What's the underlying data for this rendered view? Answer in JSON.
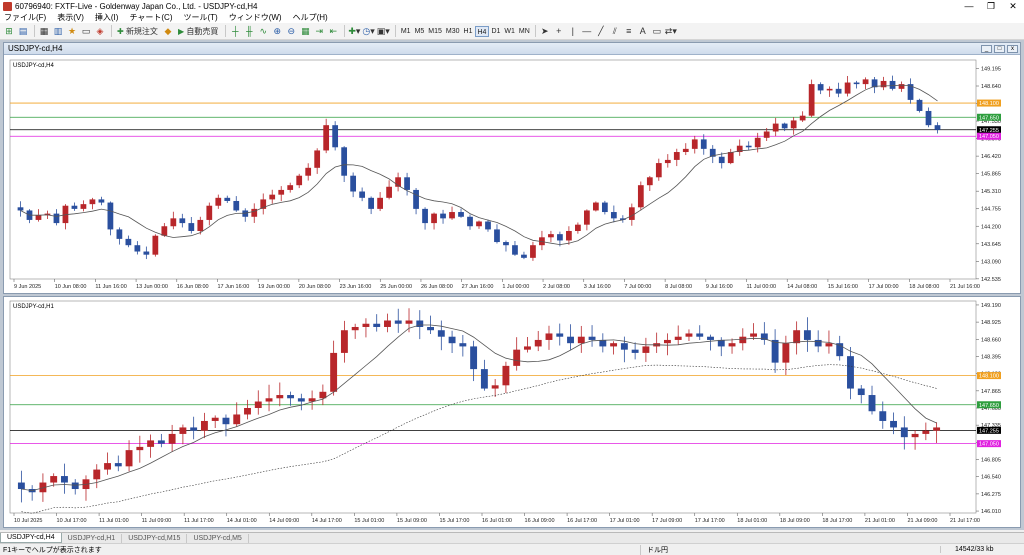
{
  "window": {
    "title": "60796940: FXTF-Live - Goldenway Japan Co., Ltd. - USDJPY-cd,H4",
    "minimize": "—",
    "maximize": "❐",
    "close": "✕"
  },
  "menu": [
    "ファイル(F)",
    "表示(V)",
    "挿入(I)",
    "チャート(C)",
    "ツール(T)",
    "ウィンドウ(W)",
    "ヘルプ(H)"
  ],
  "toolbar": {
    "new_order": "新規注文",
    "auto_trade": "自動売買",
    "timeframes": [
      "M1",
      "M5",
      "M15",
      "M30",
      "H1",
      "H4",
      "D1",
      "W1",
      "MN"
    ],
    "active_timeframe": "H4"
  },
  "chart_data": [
    {
      "type": "candlestick",
      "name": "USDJPY-cd,H4",
      "window_title": "USDJPY-cd,H4",
      "ylim": [
        142.53,
        149.4
      ],
      "y_ticks": [
        "149.195",
        "148.640",
        "148.085",
        "147.530",
        "146.975",
        "146.420",
        "145.865",
        "145.310",
        "144.755",
        "144.200",
        "143.645",
        "143.090",
        "142.535"
      ],
      "x_ticks": [
        "9 Jun 2025",
        "10 Jun 08:00",
        "11 Jun 16:00",
        "13 Jun 00:00",
        "16 Jun 08:00",
        "17 Jun 16:00",
        "19 Jun 00:00",
        "20 Jun 08:00",
        "23 Jun 16:00",
        "25 Jun 00:00",
        "26 Jun 08:00",
        "27 Jun 16:00",
        "1 Jul 00:00",
        "2 Jul 08:00",
        "3 Jul 16:00",
        "7 Jul 00:00",
        "8 Jul 08:00",
        "9 Jul 16:00",
        "11 Jul 00:00",
        "14 Jul 08:00",
        "15 Jul 16:00",
        "17 Jul 00:00",
        "18 Jul 08:00",
        "21 Jul 16:00"
      ],
      "hlines": [
        {
          "label": "148.100",
          "value": 148.1,
          "color": "#f0a020"
        },
        {
          "label": "147.650",
          "value": 147.65,
          "color": "#2e9e3e"
        },
        {
          "label": "147.255",
          "value": 147.255,
          "color": "#000000"
        },
        {
          "label": "147.050",
          "value": 147.05,
          "color": "#e020e0"
        }
      ],
      "closes": [
        144.7,
        144.4,
        144.55,
        144.6,
        144.3,
        144.85,
        144.75,
        144.9,
        145.05,
        144.95,
        144.1,
        143.8,
        143.6,
        143.4,
        143.3,
        143.9,
        144.2,
        144.45,
        144.3,
        144.05,
        144.4,
        144.85,
        145.1,
        145.0,
        144.7,
        144.5,
        144.75,
        145.05,
        145.2,
        145.35,
        145.5,
        145.8,
        146.05,
        146.6,
        147.4,
        146.7,
        145.8,
        145.3,
        145.1,
        144.75,
        145.1,
        145.45,
        145.75,
        145.35,
        144.75,
        144.3,
        144.6,
        144.45,
        144.65,
        144.5,
        144.2,
        144.35,
        144.1,
        143.7,
        143.6,
        143.3,
        143.2,
        143.6,
        143.85,
        143.95,
        143.75,
        144.05,
        144.25,
        144.7,
        144.95,
        144.65,
        144.45,
        144.4,
        144.8,
        145.5,
        145.75,
        146.2,
        146.3,
        146.55,
        146.65,
        146.95,
        146.65,
        146.4,
        146.2,
        146.55,
        146.75,
        146.7,
        147.0,
        147.2,
        147.45,
        147.3,
        147.55,
        147.7,
        148.7,
        148.5,
        148.55,
        148.4,
        148.75,
        148.7,
        148.85,
        148.6,
        148.8,
        148.55,
        148.7,
        148.2,
        147.85,
        147.4,
        147.25
      ]
    },
    {
      "type": "candlestick",
      "name": "USDJPY-cd,H1",
      "ylim": [
        145.98,
        149.22
      ],
      "y_ticks": [
        "149.190",
        "148.925",
        "148.660",
        "148.395",
        "148.130",
        "147.865",
        "147.600",
        "147.335",
        "147.070",
        "146.805",
        "146.540",
        "146.275",
        "146.010"
      ],
      "x_ticks": [
        "10 Jul 2025",
        "10 Jul 17:00",
        "11 Jul 01:00",
        "11 Jul 09:00",
        "11 Jul 17:00",
        "14 Jul 01:00",
        "14 Jul 09:00",
        "14 Jul 17:00",
        "15 Jul 01:00",
        "15 Jul 09:00",
        "15 Jul 17:00",
        "16 Jul 01:00",
        "16 Jul 09:00",
        "16 Jul 17:00",
        "17 Jul 01:00",
        "17 Jul 09:00",
        "17 Jul 17:00",
        "18 Jul 01:00",
        "18 Jul 09:00",
        "18 Jul 17:00",
        "21 Jul 01:00",
        "21 Jul 09:00",
        "21 Jul 17:00"
      ],
      "hlines": [
        {
          "label": "148.100",
          "value": 148.1,
          "color": "#f0a020"
        },
        {
          "label": "147.650",
          "value": 147.65,
          "color": "#2e9e3e"
        },
        {
          "label": "147.255",
          "value": 147.255,
          "color": "#000000"
        },
        {
          "label": "147.050",
          "value": 147.05,
          "color": "#e020e0"
        }
      ],
      "closes": [
        146.35,
        146.3,
        146.45,
        146.55,
        146.45,
        146.35,
        146.5,
        146.65,
        146.75,
        146.7,
        146.95,
        147.0,
        147.1,
        147.05,
        147.2,
        147.3,
        147.25,
        147.4,
        147.45,
        147.35,
        147.5,
        147.6,
        147.7,
        147.75,
        147.8,
        147.75,
        147.7,
        147.75,
        147.85,
        148.45,
        148.8,
        148.85,
        148.9,
        148.85,
        148.95,
        148.9,
        148.95,
        148.85,
        148.8,
        148.7,
        148.6,
        148.55,
        148.2,
        147.9,
        147.95,
        148.25,
        148.5,
        148.55,
        148.65,
        148.75,
        148.7,
        148.6,
        148.7,
        148.65,
        148.55,
        148.6,
        148.5,
        148.45,
        148.55,
        148.6,
        148.65,
        148.7,
        148.75,
        148.7,
        148.65,
        148.55,
        148.6,
        148.7,
        148.75,
        148.65,
        148.3,
        148.6,
        148.8,
        148.65,
        148.55,
        148.6,
        148.4,
        147.9,
        147.8,
        147.55,
        147.4,
        147.3,
        147.15,
        147.2,
        147.25,
        147.3
      ]
    }
  ],
  "tabs": [
    "USDJPY-cd,H4",
    "USDJPY-cd,H1",
    "USDJPY-cd,M15",
    "USDJPY-cd,M5"
  ],
  "active_tab": "USDJPY-cd,H4",
  "status": {
    "help": "F1キーでヘルプが表示されます",
    "profile": "ドル円",
    "traffic": "14542/33 kb"
  },
  "colors": {
    "bull": "#b8262a",
    "bear": "#2a4f9e",
    "ma": "#555555"
  }
}
